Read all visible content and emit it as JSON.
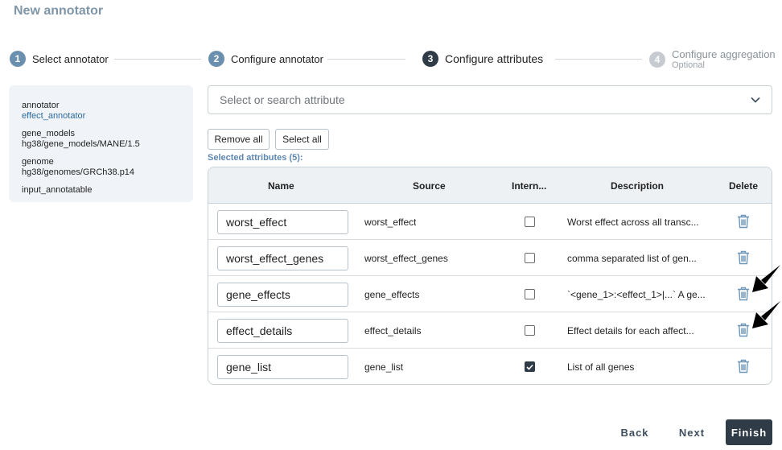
{
  "page": {
    "title": "New annotator"
  },
  "stepper": {
    "steps": [
      {
        "number": "1",
        "label": "Select annotator",
        "state": "done",
        "color": "#6b8fae"
      },
      {
        "number": "2",
        "label": "Configure annotator",
        "state": "done",
        "color": "#6b8fae"
      },
      {
        "number": "3",
        "label": "Configure attributes",
        "state": "active",
        "color": "#2f3c48"
      },
      {
        "number": "4",
        "label": "Configure aggregation",
        "sublabel": "Optional",
        "state": "pending",
        "color": "#c5cbd1"
      }
    ]
  },
  "summary": {
    "items": [
      {
        "key": "annotator",
        "value": "effect_annotator"
      },
      {
        "key": "gene_models",
        "value": "hg38/gene_models/MANE/1.5"
      },
      {
        "key": "genome",
        "value": "hg38/genomes/GRCh38.p14"
      },
      {
        "key": "input_annotatable",
        "value": ""
      }
    ]
  },
  "attribute_select": {
    "placeholder": "Select or search attribute",
    "icon": "chevron-down-icon"
  },
  "actions": {
    "remove_all": "Remove all",
    "select_all": "Select all"
  },
  "selected_label": "Selected attributes (5):",
  "table": {
    "headers": {
      "name": "Name",
      "source": "Source",
      "internal": "Intern...",
      "description": "Description",
      "delete": "Delete"
    },
    "rows": [
      {
        "name": "worst_effect",
        "source": "worst_effect",
        "internal": false,
        "description": "Worst effect across all transc..."
      },
      {
        "name": "worst_effect_genes",
        "source": "worst_effect_genes",
        "internal": false,
        "description": "comma separated list of gen..."
      },
      {
        "name": "gene_effects",
        "source": "gene_effects",
        "internal": false,
        "description": "`<gene_1>:<effect_1>|...` A ge..."
      },
      {
        "name": "effect_details",
        "source": "effect_details",
        "internal": false,
        "description": "Effect details for each affect..."
      },
      {
        "name": "gene_list",
        "source": "gene_list",
        "internal": true,
        "description": "List of all genes"
      }
    ]
  },
  "footer": {
    "back": "Back",
    "next": "Next",
    "finish": "Finish"
  },
  "colors": {
    "accent": "#2f3c48",
    "trash": "#6d96b8",
    "title": "#7f95a8"
  }
}
